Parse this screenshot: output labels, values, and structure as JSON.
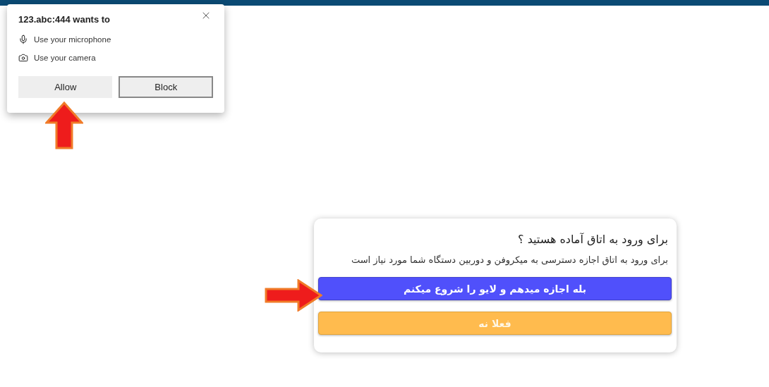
{
  "permission_popup": {
    "title": "123.abc:444 wants to",
    "permissions": [
      {
        "kind": "microphone",
        "label": "Use your microphone"
      },
      {
        "kind": "camera",
        "label": "Use your camera"
      }
    ],
    "allow_button": {
      "label": "Allow"
    },
    "block_button": {
      "label": "Block"
    }
  },
  "room_card": {
    "title": "برای ورود به اتاق آماده هستید ؟",
    "message": "برای ورود به اتاق اجازه دسترسی به میکروفن و دوربین دستگاه شما مورد نیاز است",
    "buttons": [
      {
        "kind": "primary",
        "label": "بله اجازه میدهم و لایو را شروع میکنم"
      },
      {
        "kind": "secondary",
        "label": "فعلا نه"
      }
    ]
  }
}
